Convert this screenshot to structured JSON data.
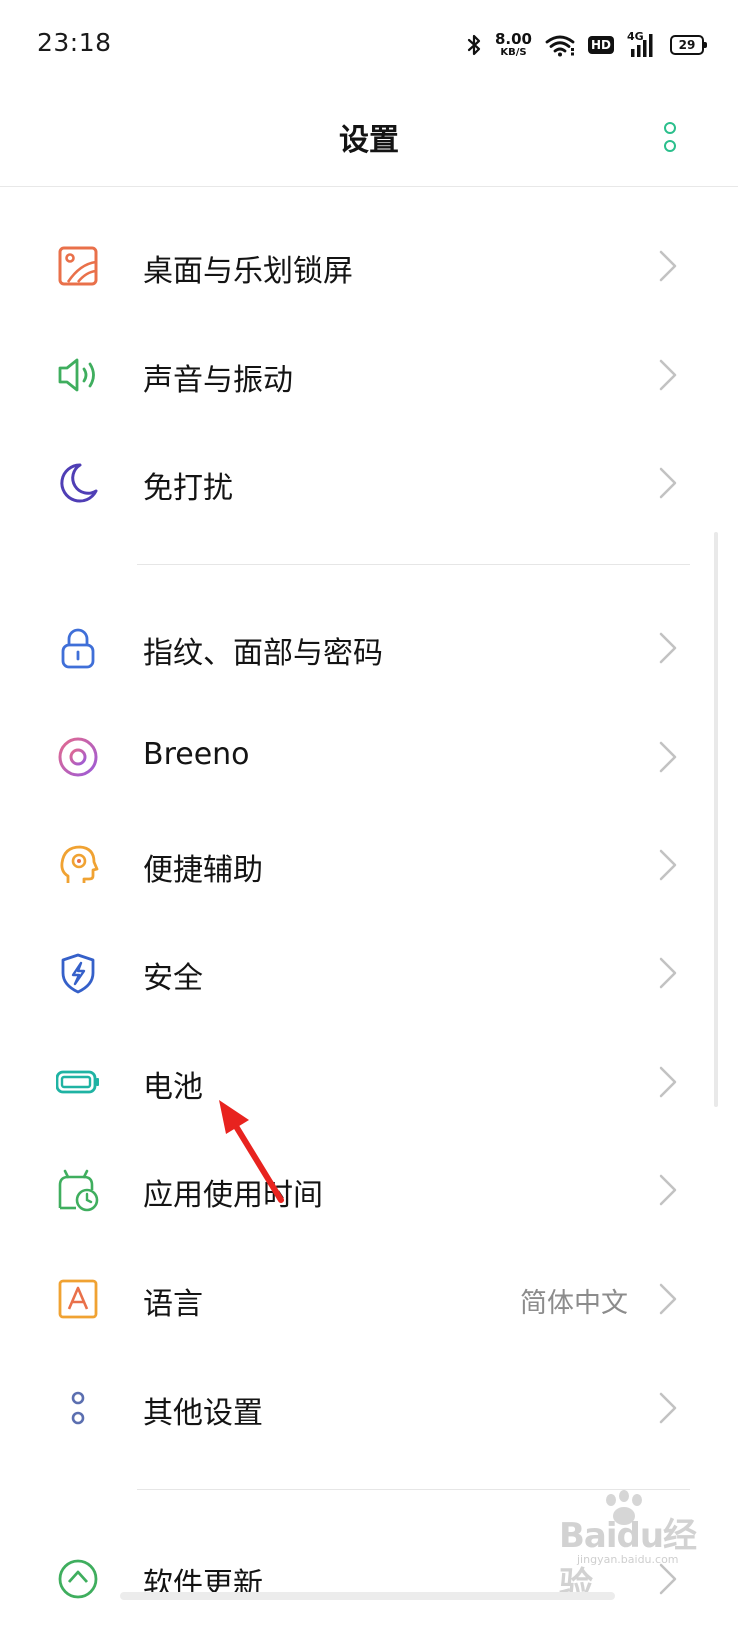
{
  "status_bar": {
    "time": "23:18",
    "net_speed_value": "8.00",
    "net_speed_unit": "KB/S",
    "hd_badge": "HD",
    "network_type": "4G",
    "battery_level": "29",
    "icons": [
      "bluetooth-icon",
      "wifi-icon",
      "signal-icon",
      "battery-icon"
    ]
  },
  "header": {
    "title": "设置",
    "more_icon": "more-vertical-icon"
  },
  "settings": {
    "items": [
      {
        "label": "桌面与乐划锁屏",
        "icon": "wallpaper-icon",
        "icon_color": "#e9704a"
      },
      {
        "label": "声音与振动",
        "icon": "speaker-icon",
        "icon_color": "#3fae5e"
      },
      {
        "label": "免打扰",
        "icon": "moon-icon",
        "icon_color": "#4f3eb5"
      },
      {
        "label": "指纹、面部与密码",
        "icon": "lock-icon",
        "icon_color": "#3f6fd8"
      },
      {
        "label": "Breeno",
        "icon": "breeno-icon",
        "icon_color": "#c75bd6"
      },
      {
        "label": "便捷辅助",
        "icon": "assist-head-icon",
        "icon_color": "#f0a232"
      },
      {
        "label": "安全",
        "icon": "shield-icon",
        "icon_color": "#3560c9"
      },
      {
        "label": "电池",
        "icon": "battery-icon",
        "icon_color": "#1fb3a3"
      },
      {
        "label": "应用使用时间",
        "icon": "app-usage-time-icon",
        "icon_color": "#3fae5e"
      },
      {
        "label": "语言",
        "value": "简体中文",
        "icon": "language-icon",
        "icon_color": "#f0a232"
      },
      {
        "label": "其他设置",
        "icon": "other-settings-icon",
        "icon_color": "#5b6fb0"
      },
      {
        "label": "软件更新",
        "icon": "update-icon",
        "icon_color": "#3fae5e"
      }
    ]
  },
  "watermark": {
    "text": "Baidu经验",
    "sub": "jingyan.baidu.com"
  }
}
